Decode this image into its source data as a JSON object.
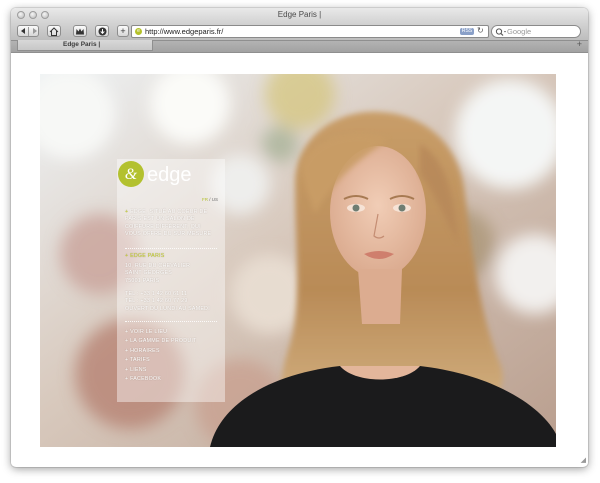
{
  "window": {
    "title": "Edge Paris |"
  },
  "toolbar": {
    "url": "http://www.edgeparis.fr/",
    "rss_label": "RSS",
    "search_placeholder": "Google",
    "add_label": "+"
  },
  "tabs": [
    {
      "label": "Edge Paris |"
    }
  ],
  "page": {
    "logo_text": "edge",
    "languages": {
      "fr": "FR",
      "separator": "/",
      "us": "US"
    },
    "intro": {
      "marker": "+",
      "text": "EDGE, SITUÉ AU COEUR DE PARIS  EST UN SALON DE COIFFURE DIFFÉRENT, QUI VOUS OFFRE DU SUR MESURE"
    },
    "address_label": "+ EDGE PARIS",
    "address": [
      "10, RUE DU CHEVALIER",
      "SAINT GEORGES",
      "75001 PARIS"
    ],
    "phones": [
      "TEL : +33 1 42 60 61 11",
      "TEL : +33 1 42 60 77 29",
      "OUVERT DU LUNDI AU SAMEDI"
    ],
    "menu": [
      {
        "label": "+ VOIR LE LIEU"
      },
      {
        "label": "+ LA GAMME DE PRODUIT"
      },
      {
        "label": "+ HORAIRES"
      },
      {
        "label": "+ TARIFS"
      },
      {
        "label": "+ LIENS"
      },
      {
        "label": "+ FACEBOOK"
      }
    ]
  },
  "colors": {
    "accent": "#b3c12f",
    "panel_text": "#ffffff"
  }
}
